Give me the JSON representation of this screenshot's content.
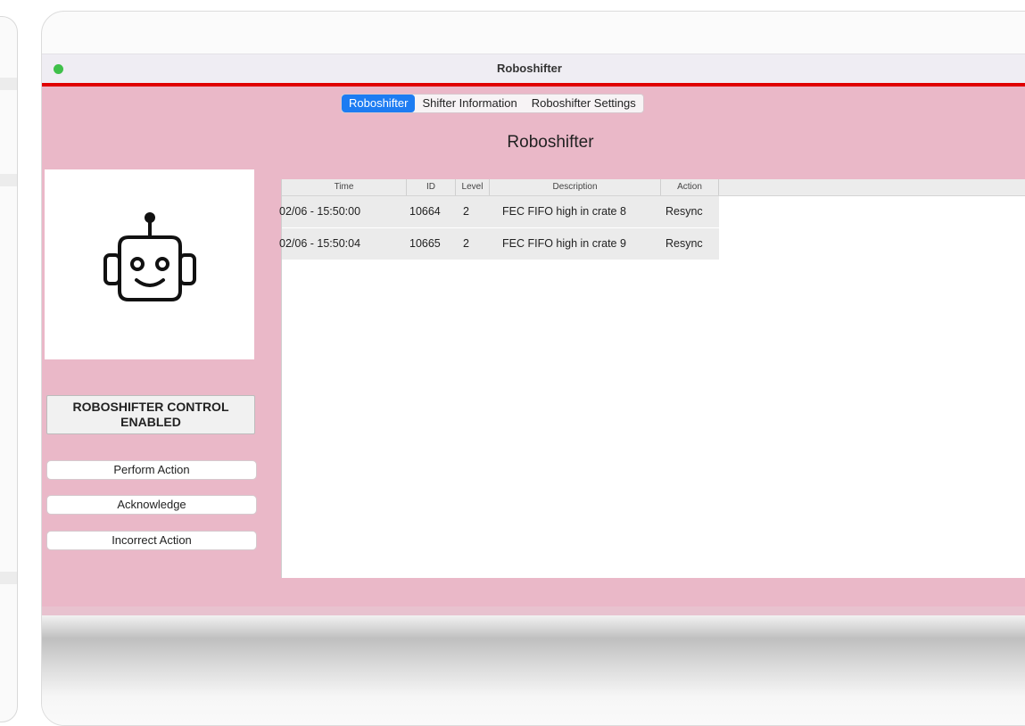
{
  "window": {
    "title": "Roboshifter"
  },
  "tabs": [
    {
      "label": "Roboshifter",
      "active": true
    },
    {
      "label": "Shifter Information",
      "active": false
    },
    {
      "label": "Roboshifter Settings",
      "active": false
    }
  ],
  "main": {
    "heading": "Roboshifter"
  },
  "robot": {
    "icon": "robot-icon"
  },
  "controls": {
    "status_line1": "ROBOSHIFTER CONTROL",
    "status_line2": "ENABLED",
    "perform_action": "Perform Action",
    "acknowledge": "Acknowledge",
    "incorrect_action": "Incorrect Action"
  },
  "table": {
    "columns": [
      "Time",
      "ID",
      "Level",
      "Description",
      "Action"
    ],
    "rows": [
      {
        "time": "02/06 - 15:50:00",
        "id": "10664",
        "level": "2",
        "description": "FEC FIFO high in crate 8",
        "action": "Resync"
      },
      {
        "time": "02/06 - 15:50:04",
        "id": "10665",
        "level": "2",
        "description": "FEC FIFO high in crate 9",
        "action": "Resync"
      }
    ]
  },
  "colors": {
    "accent": "#1d7cf2",
    "background": "#eab8c8",
    "alert_bar": "#e00000",
    "status_light": "#3fc04a"
  }
}
